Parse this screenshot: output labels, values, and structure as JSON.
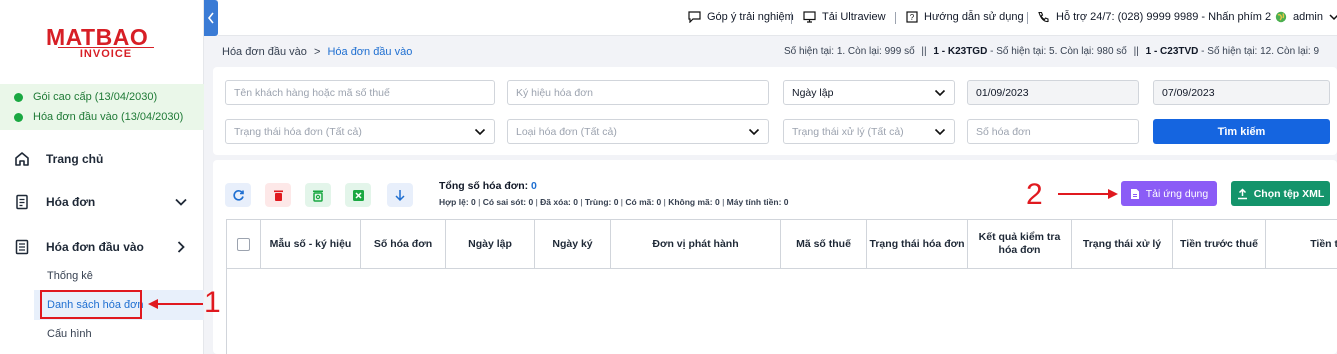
{
  "brand": {
    "logo_top": "MATBAO",
    "logo_bottom": "INVOICE"
  },
  "packages": [
    {
      "label": "Gói cao cấp (13/04/2030)"
    },
    {
      "label": "Hóa đơn đầu vào (13/04/2030)"
    }
  ],
  "sidebar": {
    "items": [
      {
        "label": "Trang chủ",
        "icon": "home-icon"
      },
      {
        "label": "Hóa đơn",
        "icon": "document-icon",
        "chevron": "chevron-down-icon"
      },
      {
        "label": "Hóa đơn đầu vào",
        "icon": "document-list-icon",
        "chevron": "chevron-right-icon"
      }
    ],
    "subitems": [
      {
        "label": "Thống kê"
      },
      {
        "label": "Danh sách hóa đơn",
        "active": true
      },
      {
        "label": "Cấu hình"
      }
    ]
  },
  "topbar": {
    "feedback": "Góp ý trải nghiệm",
    "ultraview": "Tải Ultraview",
    "guide": "Hướng dẫn sử dụng",
    "support": "Hỗ trợ 24/7: (028) 9999 9989 - Nhấn phím 2",
    "user": "admin"
  },
  "breadcrumb": {
    "parent": "Hóa đơn đầu vào",
    "separator": ">",
    "current": "Hóa đơn đầu vào"
  },
  "quota": {
    "q1": "Số hiện tại: 1. Còn lại: 999 số",
    "sep": "||",
    "q2_code": "1 - K23TGD",
    "q2": " - Số hiện tại: 5. Còn lại: 980 số",
    "q3_code": "1 - C23TVD",
    "q3": " - Số hiện tại: 12. Còn lại: 9"
  },
  "filters": {
    "customer_placeholder": "Tên khách hàng hoặc mã số thuế",
    "symbol_placeholder": "Ký hiệu hóa đơn",
    "date_type": "Ngày lập",
    "date_from": "01/09/2023",
    "date_to": "07/09/2023",
    "status_placeholder": "Trạng thái hóa đơn (Tất cả)",
    "type_placeholder": "Loại hóa đơn (Tất cả)",
    "process_placeholder": "Trạng thái xử lý (Tất cả)",
    "number_placeholder": "Số hóa đơn",
    "search_label": "Tìm kiếm"
  },
  "summary": {
    "total_label": "Tổng số hóa đơn:",
    "total_value": "0",
    "stats": [
      "Hợp lệ: 0",
      "Có sai sót: 0",
      "Đã xóa: 0",
      "Trùng: 0",
      "Có mã: 0",
      "Không mã: 0",
      "Máy tính tiền: 0"
    ]
  },
  "actions": {
    "app_upload": "Tải ứng dụng",
    "choose_xml": "Chọn tệp XML"
  },
  "table": {
    "headers": [
      "Mẫu số - ký hiệu",
      "Số hóa đơn",
      "Ngày lập",
      "Ngày ký",
      "Đơn vị phát hành",
      "Mã số thuế",
      "Trạng thái hóa đơn",
      "Kết quả kiểm tra hóa đơn",
      "Trạng thái xử lý",
      "Tiền trước thuế",
      "Tiền t"
    ]
  },
  "annotations": {
    "n1": "1",
    "n2": "2"
  },
  "colors": {
    "primary": "#1565e0",
    "purple": "#8b5cf6",
    "green": "#14946b",
    "red": "#e0191f",
    "brand_red": "#d71f26"
  }
}
